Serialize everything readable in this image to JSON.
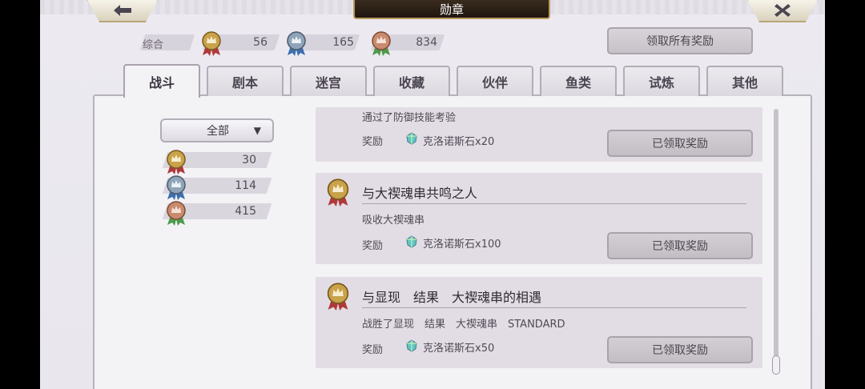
{
  "header": {
    "title": "勋章"
  },
  "summary": {
    "label": "综合",
    "gold": "56",
    "silver": "165",
    "bronze": "834",
    "claim_all_label": "领取所有奖励"
  },
  "tabs": [
    {
      "label": "战斗",
      "active": true
    },
    {
      "label": "剧本"
    },
    {
      "label": "迷宫"
    },
    {
      "label": "收藏"
    },
    {
      "label": "伙伴"
    },
    {
      "label": "鱼类"
    },
    {
      "label": "试炼"
    },
    {
      "label": "其他"
    }
  ],
  "filter": {
    "selected": "全部",
    "arrow": "▼"
  },
  "counts": {
    "gold": "30",
    "silver": "114",
    "bronze": "415"
  },
  "cards": [
    {
      "title": "",
      "desc": "通过了防御技能考验",
      "reward_label": "奖励",
      "reward": "克洛诺斯石x20",
      "button": "已领取奖励"
    },
    {
      "title": "与大禊魂串共鸣之人",
      "desc": "吸收大禊魂串",
      "reward_label": "奖励",
      "reward": "克洛诺斯石x100",
      "button": "已领取奖励"
    },
    {
      "title": "与显现　结果　大禊魂串的相遇",
      "desc": "战胜了显现　结果　大禊魂串　STANDARD",
      "reward_label": "奖励",
      "reward": "克洛诺斯石x50",
      "button": "已领取奖励"
    }
  ],
  "colors": {
    "gold": "#c9a24a",
    "silver": "#8fa4b8",
    "bronze": "#c98a6e",
    "ribbon_red": "#b0383a",
    "ribbon_blue": "#3d6fb0",
    "ribbon_green": "#4e9a4a"
  }
}
